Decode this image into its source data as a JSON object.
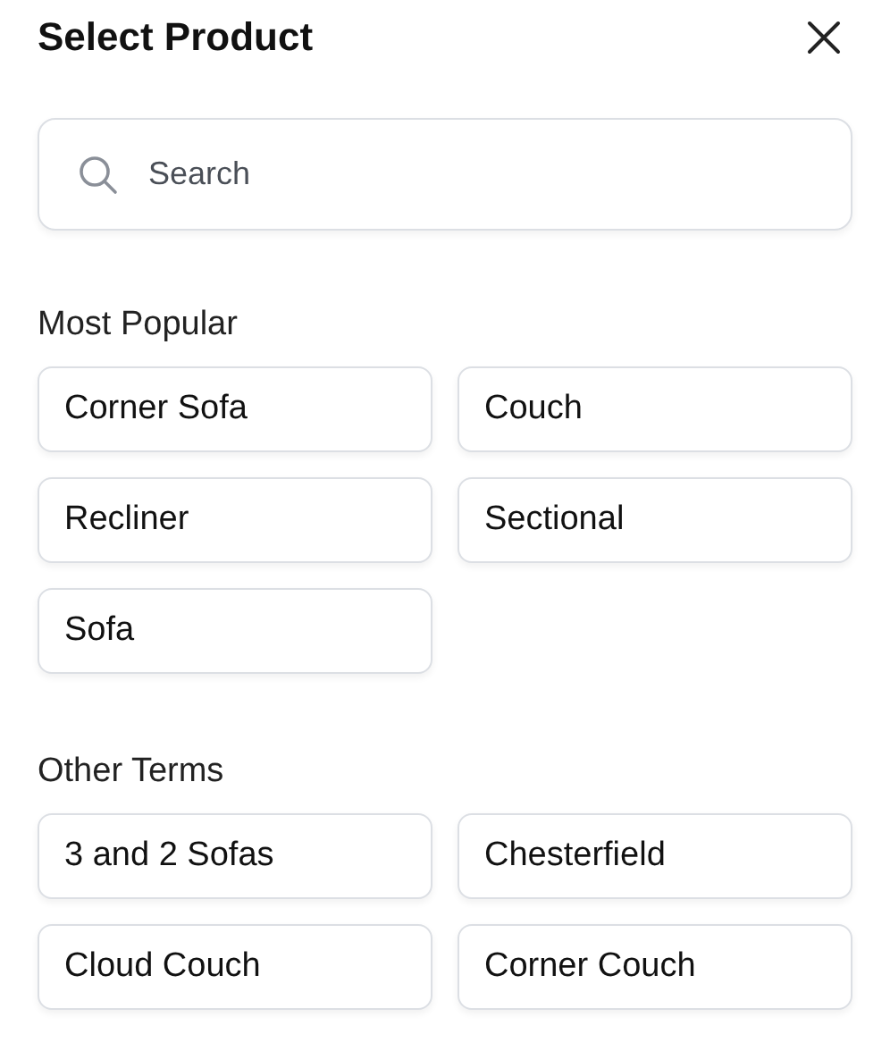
{
  "title": "Select Product",
  "search": {
    "placeholder": "Search"
  },
  "sections": [
    {
      "heading": "Most Popular",
      "items": [
        "Corner Sofa",
        "Couch",
        "Recliner",
        "Sectional",
        "Sofa"
      ]
    },
    {
      "heading": "Other Terms",
      "items": [
        "3 and 2 Sofas",
        "Chesterfield",
        "Cloud Couch",
        "Corner Couch"
      ]
    }
  ]
}
